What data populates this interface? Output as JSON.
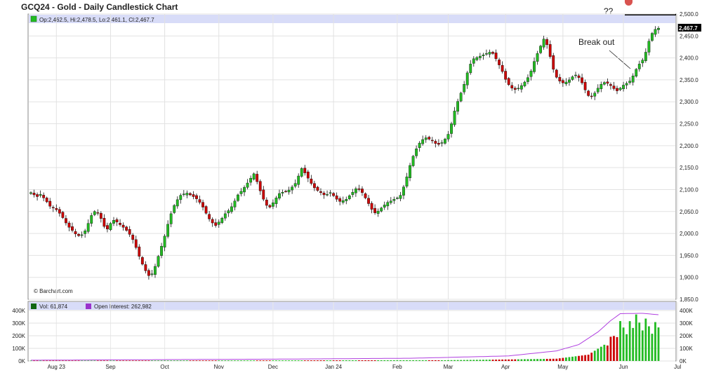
{
  "header": {
    "title": "GCQ24 - Gold - Daily Candlestick Chart",
    "question_marks": "??"
  },
  "ohlc": {
    "label": "Op:2,462.5, Hi:2,478.5, Lo:2,461.1, Cl:2,467.7",
    "last_price_label": "2,467.7"
  },
  "copyright": "© Barchart.com",
  "annotation": "Break out",
  "colors": {
    "up": "#22bb22",
    "down": "#cc0000",
    "open_interest": "#b040e0",
    "legend_bg": "#d8dcf8"
  },
  "volume_legend": {
    "volume": "Vol: 61,874",
    "open_interest": "Open Interest: 262,982"
  },
  "chart_data": [
    {
      "type": "candlestick",
      "title": "GCQ24 - Gold - Daily Candlestick Chart",
      "ylim": [
        1850,
        2500
      ],
      "y_ticks": [
        "1,850.0",
        "1,900.0",
        "1,950.0",
        "2,000.0",
        "2,050.0",
        "2,100.0",
        "2,150.0",
        "2,200.0",
        "2,250.0",
        "2,300.0",
        "2,350.0",
        "2,400.0",
        "2,450.0",
        "2,500.0"
      ],
      "x_ticks": [
        "Aug 23",
        "Sep",
        "Oct",
        "Nov",
        "Dec",
        "Jan 24",
        "Feb",
        "Mar",
        "Apr",
        "May",
        "Jun",
        "Jul"
      ],
      "x_tick_index": [
        8,
        25,
        42,
        59,
        76,
        95,
        115,
        131,
        149,
        167,
        186,
        203
      ],
      "grid": true,
      "close": [
        2093,
        2088,
        2084,
        2089,
        2081,
        2072,
        2062,
        2058,
        2054,
        2046,
        2036,
        2024,
        2014,
        2007,
        1999,
        1995,
        1997,
        2006,
        2023,
        2041,
        2050,
        2047,
        2034,
        2016,
        2010,
        2023,
        2030,
        2026,
        2020,
        2014,
        2007,
        1998,
        1986,
        1968,
        1948,
        1930,
        1915,
        1904,
        1908,
        1925,
        1948,
        1971,
        1994,
        2021,
        2045,
        2064,
        2077,
        2087,
        2090,
        2092,
        2088,
        2084,
        2079,
        2071,
        2060,
        2046,
        2033,
        2024,
        2018,
        2026,
        2035,
        2045,
        2052,
        2061,
        2074,
        2088,
        2096,
        2105,
        2115,
        2126,
        2136,
        2118,
        2097,
        2078,
        2064,
        2060,
        2070,
        2081,
        2091,
        2094,
        2096,
        2099,
        2106,
        2114,
        2131,
        2148,
        2138,
        2126,
        2114,
        2104,
        2098,
        2093,
        2088,
        2089,
        2093,
        2086,
        2078,
        2073,
        2075,
        2078,
        2086,
        2094,
        2102,
        2100,
        2093,
        2081,
        2068,
        2055,
        2047,
        2051,
        2058,
        2065,
        2071,
        2074,
        2078,
        2081,
        2087,
        2106,
        2129,
        2155,
        2176,
        2193,
        2206,
        2214,
        2218,
        2215,
        2211,
        2205,
        2203,
        2207,
        2215,
        2226,
        2250,
        2279,
        2301,
        2320,
        2340,
        2366,
        2386,
        2398,
        2401,
        2404,
        2407,
        2410,
        2413,
        2410,
        2398,
        2384,
        2369,
        2351,
        2339,
        2331,
        2328,
        2331,
        2337,
        2345,
        2355,
        2370,
        2392,
        2410,
        2427,
        2443,
        2430,
        2403,
        2374,
        2356,
        2347,
        2343,
        2345,
        2350,
        2357,
        2361,
        2355,
        2343,
        2327,
        2314,
        2312,
        2320,
        2331,
        2340,
        2344,
        2342,
        2337,
        2330,
        2325,
        2331,
        2338,
        2342,
        2347,
        2359,
        2374,
        2386,
        2395,
        2413,
        2438,
        2456,
        2465,
        2467.7
      ],
      "open_interest_points": [
        [
          0,
          6000
        ],
        [
          80,
          15000
        ],
        [
          120,
          22000
        ],
        [
          150,
          40000
        ],
        [
          165,
          80000
        ],
        [
          172,
          130000
        ],
        [
          178,
          230000
        ],
        [
          182,
          320000
        ],
        [
          185,
          375000
        ],
        [
          192,
          378000
        ],
        [
          200,
          360000
        ],
        [
          204,
          345000
        ],
        [
          207,
          340000
        ],
        [
          211,
          330000
        ],
        [
          214,
          262982
        ]
      ],
      "volume_points": [
        [
          0,
          3000
        ],
        [
          130,
          6000
        ],
        [
          150,
          12000
        ],
        [
          165,
          18000
        ],
        [
          175,
          50000
        ],
        [
          182,
          160000
        ],
        [
          185,
          275000
        ],
        [
          190,
          295000
        ],
        [
          195,
          270000
        ],
        [
          200,
          260000
        ],
        [
          205,
          280000
        ],
        [
          210,
          320000
        ],
        [
          214,
          61874
        ]
      ]
    },
    {
      "type": "bar",
      "title": "",
      "ylim": [
        0,
        400000
      ],
      "y_ticks_left": [
        "0K",
        "100K",
        "200K",
        "300K",
        "400K"
      ],
      "y_ticks_right": [
        "0K",
        "100K",
        "200K",
        "300K",
        "400K"
      ]
    }
  ]
}
